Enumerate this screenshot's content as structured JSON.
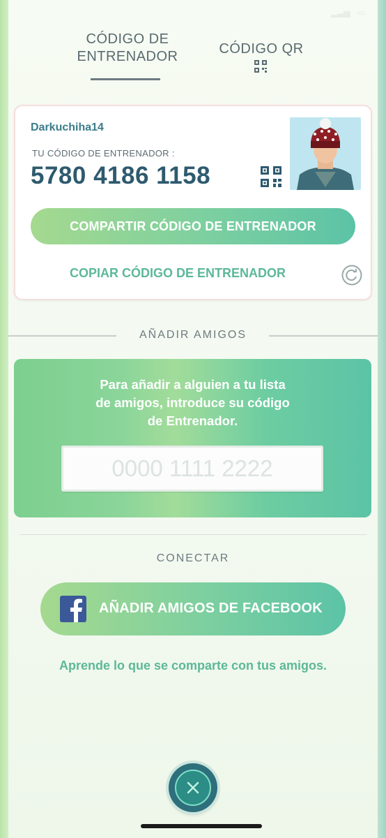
{
  "tabs": {
    "trainer_code_line1": "CÓDIGO DE",
    "trainer_code_line2": "ENTRENADOR",
    "qr_code": "CÓDIGO QR"
  },
  "card": {
    "username": "Darkuchiha14",
    "code_label": "TU CÓDIGO DE ENTRENADOR :",
    "code": "5780 4186 1158",
    "share_button": "COMPARTIR CÓDIGO DE ENTRENADOR",
    "copy_button": "COPIAR CÓDIGO DE ENTRENADOR"
  },
  "add_friends": {
    "title": "AÑADIR AMIGOS",
    "instructions_line1": "Para añadir a alguien a tu lista",
    "instructions_line2": "de amigos, introduce su código",
    "instructions_line3": "de Entrenador.",
    "input_placeholder": "0000 1111 2222"
  },
  "connect": {
    "title": "CONECTAR",
    "facebook_button": "AÑADIR AMIGOS DE FACEBOOK",
    "learn_link": "Aprende lo que se comparte con tus amigos."
  },
  "colors": {
    "accent_teal": "#5cb898",
    "code_text": "#2e5a6e",
    "facebook_blue": "#3b5998"
  }
}
